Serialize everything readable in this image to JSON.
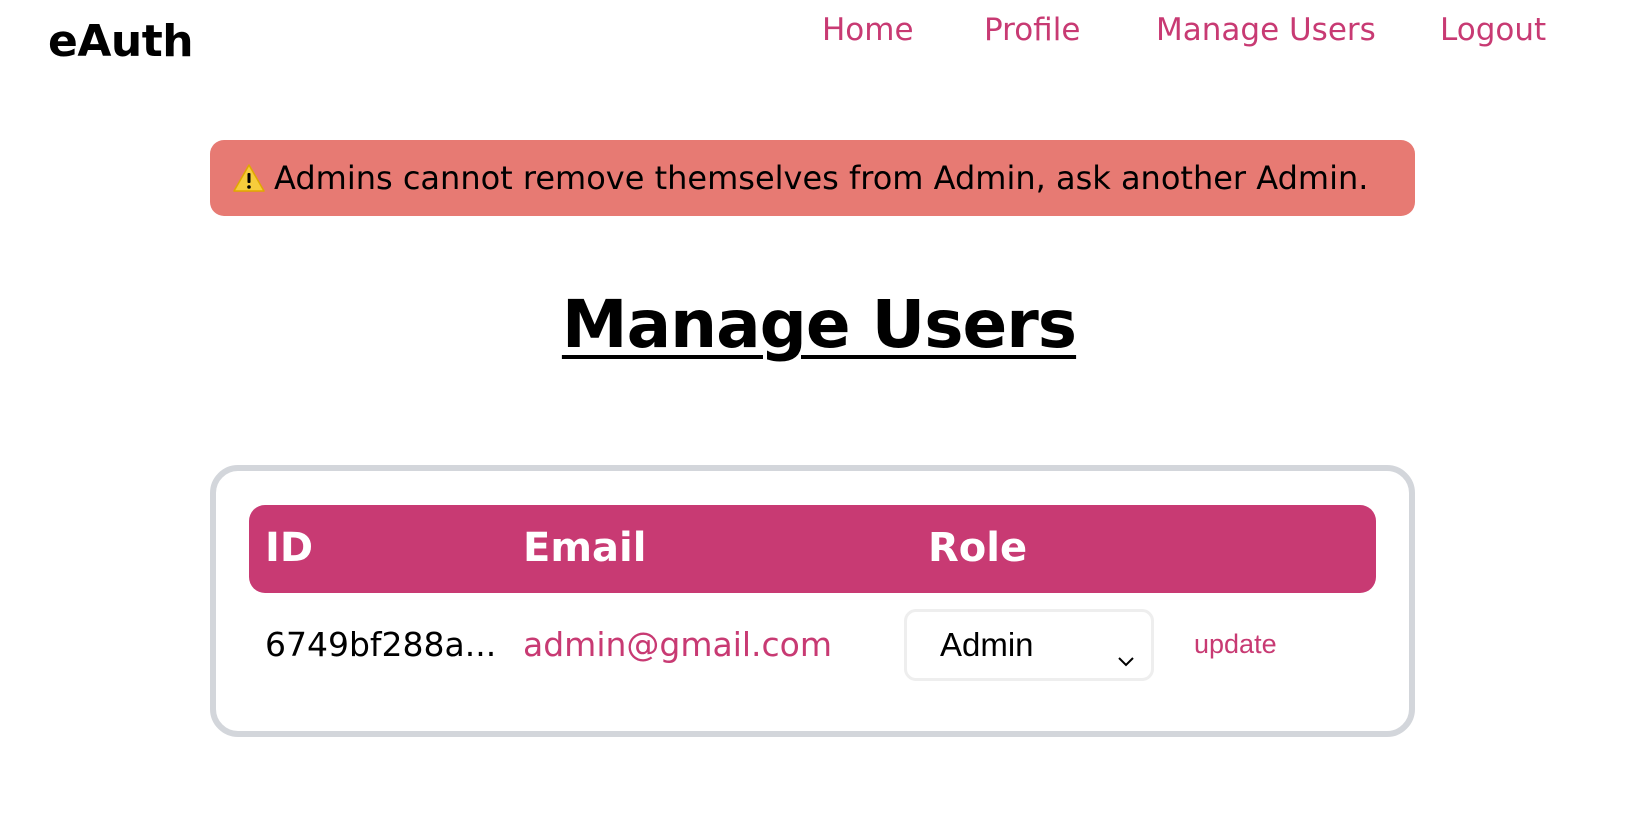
{
  "brand": "eAuth",
  "nav": {
    "home": "Home",
    "profile": "Profile",
    "manage_users": "Manage Users",
    "logout": "Logout"
  },
  "alert": {
    "icon": "warning-icon",
    "message": "Admins cannot remove themselves from Admin, ask another Admin."
  },
  "page_title": "Manage Users",
  "table": {
    "headers": [
      "ID",
      "Email",
      "Role"
    ],
    "rows": [
      {
        "id": "6749bf288a...",
        "email": "admin@gmail.com",
        "role": "Admin",
        "action": "update"
      }
    ]
  },
  "colors": {
    "accent": "#c83a73",
    "alert_bg": "#e77a73",
    "card_border": "#d3d6db"
  }
}
